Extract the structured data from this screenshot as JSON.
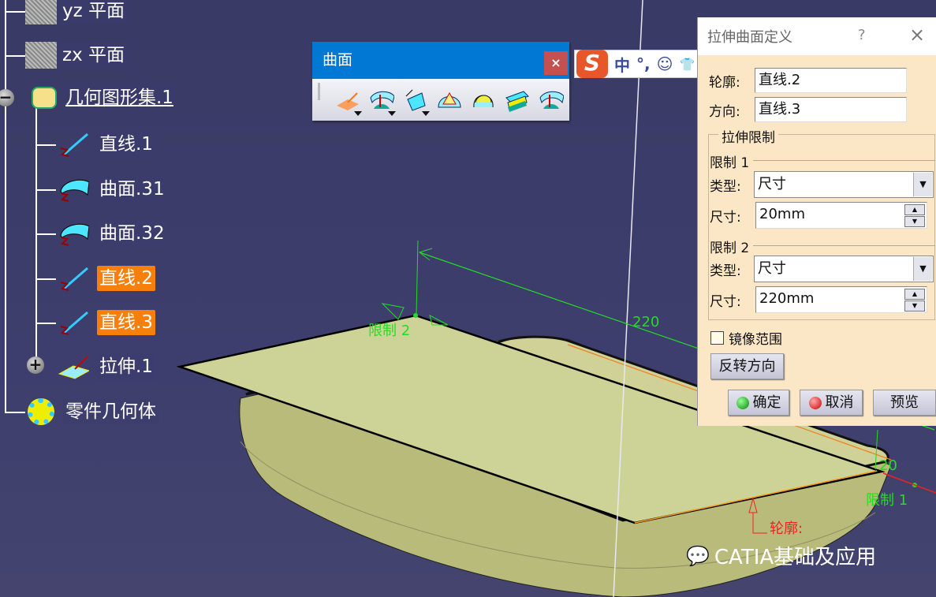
{
  "tree": {
    "items": [
      {
        "label": "yz 平面",
        "icon": "plane-icon"
      },
      {
        "label": "zx 平面",
        "icon": "plane-icon"
      },
      {
        "label": "几何图形集.1",
        "icon": "geometrical-set-icon"
      },
      {
        "label": "直线.1",
        "icon": "line-icon"
      },
      {
        "label": "曲面.31",
        "icon": "surface-icon"
      },
      {
        "label": "曲面.32",
        "icon": "surface-icon"
      },
      {
        "label": "直线.2",
        "icon": "line-icon",
        "selected": true
      },
      {
        "label": "直线.3",
        "icon": "line-icon",
        "selected": true
      },
      {
        "label": "拉伸.1",
        "icon": "extrude-icon"
      },
      {
        "label": "零件几何体",
        "icon": "part-body-icon"
      }
    ]
  },
  "toolbar": {
    "title": "曲面",
    "close": "×",
    "tools": [
      "extrude-icon",
      "revolve-icon",
      "offset-icon",
      "sweep-icon",
      "fill-icon",
      "multi-section-icon",
      "blend-icon"
    ]
  },
  "ime": {
    "logo": "S",
    "mode": "中",
    "punct": "°,",
    "emoji": "☺",
    "skin": "👕"
  },
  "dialog": {
    "title": "拉伸曲面定义",
    "help": "?",
    "close": "×",
    "profile_label": "轮廓:",
    "profile_value": "直线.2",
    "direction_label": "方向:",
    "direction_value": "直线.3",
    "limits_group": "拉伸限制",
    "limit1": {
      "title": "限制 1",
      "type_label": "类型:",
      "type_value": "尺寸",
      "dim_label": "尺寸:",
      "dim_value": "20mm"
    },
    "limit2": {
      "title": "限制 2",
      "type_label": "类型:",
      "type_value": "尺寸",
      "dim_label": "尺寸:",
      "dim_value": "220mm"
    },
    "mirror_label": "镜像范围",
    "mirror_checked": false,
    "reverse_button": "反转方向",
    "ok_button": "确定",
    "cancel_button": "取消",
    "preview_button": "预览"
  },
  "viewport": {
    "limit2_label": "限制 2",
    "limit1_label": "限制 1",
    "dim220": "220",
    "dim20": "20",
    "profile_label": "轮廓:",
    "watermark": "CATIA基础及应用"
  },
  "colors": {
    "selection": "#f7800c",
    "titlebar": "#0078d4",
    "background": "#3c3c6c",
    "dim_green": "#22dd22"
  }
}
